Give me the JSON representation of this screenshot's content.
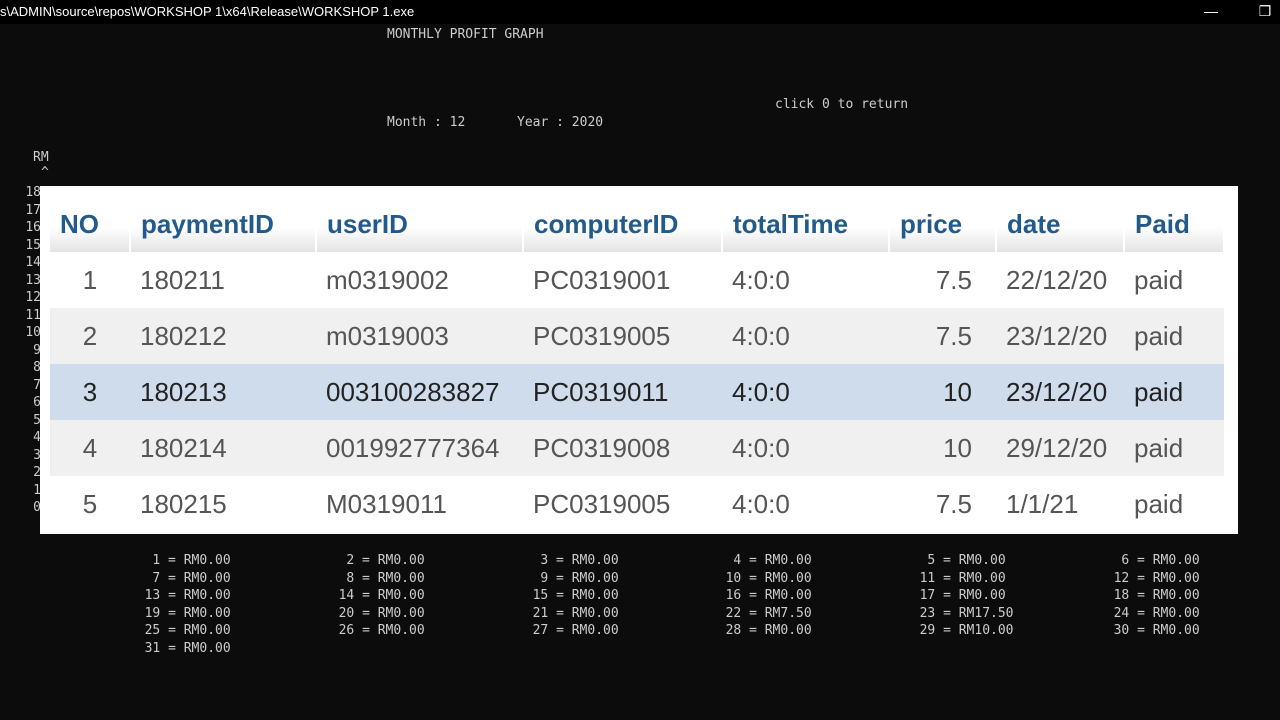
{
  "window": {
    "title": "s\\ADMIN\\source\\repos\\WORKSHOP 1\\x64\\Release\\WORKSHOP 1.exe",
    "minimize_glyph": "—",
    "restore_glyph": "❐"
  },
  "console": {
    "heading": "MONTHLY PROFIT GRAPH",
    "return_hint": "click 0 to return",
    "month_label": "Month : 12",
    "year_label": "Year : 2020",
    "y_unit": "RM",
    "y_arrow": "^",
    "y_ticks": [
      "18",
      "17",
      "16",
      "15",
      "14",
      "13",
      "12",
      "11",
      "10",
      "9",
      "8",
      "7",
      "6",
      "5",
      "4",
      "3",
      "2",
      "1",
      "0"
    ]
  },
  "payments_table": {
    "headers": [
      "NO",
      "paymentID",
      "userID",
      "computerID",
      "totalTime",
      "price",
      "date",
      "Paid"
    ],
    "rows": [
      [
        "1",
        "180211",
        "m0319002",
        "PC0319001",
        "4:0:0",
        "7.5",
        "22/12/20",
        "paid"
      ],
      [
        "2",
        "180212",
        "m0319003",
        "PC0319005",
        "4:0:0",
        "7.5",
        "23/12/20",
        "paid"
      ],
      [
        "3",
        "180213",
        "003100283827",
        "PC0319011",
        "4:0:0",
        "10",
        "23/12/20",
        "paid"
      ],
      [
        "4",
        "180214",
        "001992777364",
        "PC0319008",
        "4:0:0",
        "10",
        "29/12/20",
        "paid"
      ],
      [
        "5",
        "180215",
        "M0319011",
        "PC0319005",
        "4:0:0",
        "7.5",
        "1/1/21",
        "paid"
      ]
    ],
    "selected_row": 3
  },
  "daily_totals": [
    "1 = RM0.00",
    "2 = RM0.00",
    "3 = RM0.00",
    "4 = RM0.00",
    "5 = RM0.00",
    "6 = RM0.00",
    "7 = RM0.00",
    "8 = RM0.00",
    "9 = RM0.00",
    "10 = RM0.00",
    "11 = RM0.00",
    "12 = RM0.00",
    "13 = RM0.00",
    "14 = RM0.00",
    "15 = RM0.00",
    "16 = RM0.00",
    "17 = RM0.00",
    "18 = RM0.00",
    "19 = RM0.00",
    "20 = RM0.00",
    "21 = RM0.00",
    "22 = RM7.50",
    "23 = RM17.50",
    "24 = RM0.00",
    "25 = RM0.00",
    "26 = RM0.00",
    "27 = RM0.00",
    "28 = RM0.00",
    "29 = RM10.00",
    "30 = RM0.00",
    "31 = RM0.00"
  ],
  "colors": {
    "console_bg": "#0c0c0c",
    "console_text": "#cccccc",
    "header_text": "#235a8c",
    "selected_row": "#cfdcec",
    "alt_row": "#f0f0f0"
  }
}
